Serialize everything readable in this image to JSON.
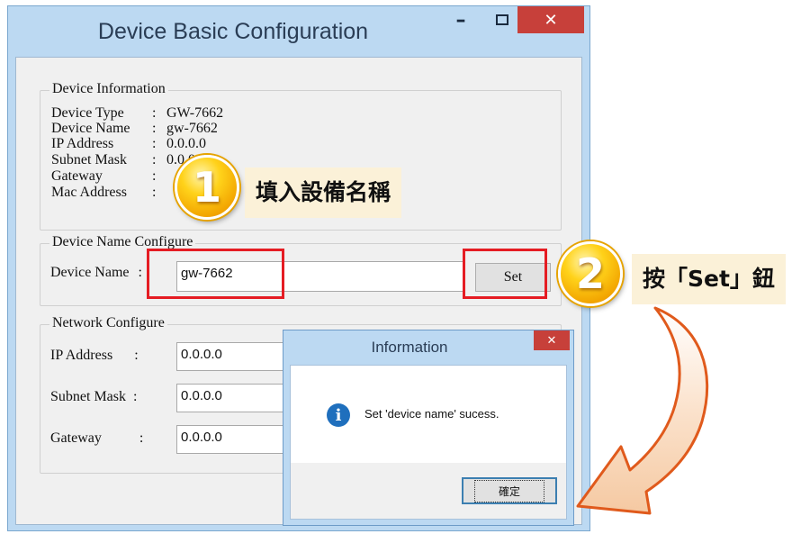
{
  "window": {
    "title": "Device Basic Configuration",
    "minimize_glyph": "–",
    "close_glyph": "✕"
  },
  "device_info": {
    "group_title": "Device Information",
    "rows": [
      {
        "label": "Device Type",
        "value": "GW-7662"
      },
      {
        "label": "Device Name",
        "value": "gw-7662"
      },
      {
        "label": "IP Address",
        "value": "0.0.0.0"
      },
      {
        "label": "Subnet Mask",
        "value": "0.0.0.0"
      },
      {
        "label": "Gateway",
        "value": ""
      },
      {
        "label": "Mac Address",
        "value": ""
      }
    ]
  },
  "name_config": {
    "group_title": "Device Name Configure",
    "label": "Device Name",
    "value": "gw-7662",
    "set_label": "Set"
  },
  "network_config": {
    "group_title": "Network Configure",
    "fields": [
      {
        "label": "IP Address",
        "value": "0.0.0.0"
      },
      {
        "label": "Subnet Mask",
        "value": "0.0.0.0"
      },
      {
        "label": "Gateway",
        "value": "0.0.0.0"
      }
    ]
  },
  "dialog": {
    "title": "Information",
    "close_glyph": "✕",
    "message": "Set 'device name' sucess.",
    "ok_label": "確定",
    "icon": "info-icon"
  },
  "annotations": {
    "step1": {
      "number": "1",
      "text": "填入設備名稱"
    },
    "step2": {
      "number": "2",
      "text": "按「Set」鈕"
    }
  },
  "colors": {
    "highlight": "#e51c23",
    "badge": "#f2a400",
    "window_frame": "#bcd9f2",
    "close_button": "#c7403a"
  }
}
